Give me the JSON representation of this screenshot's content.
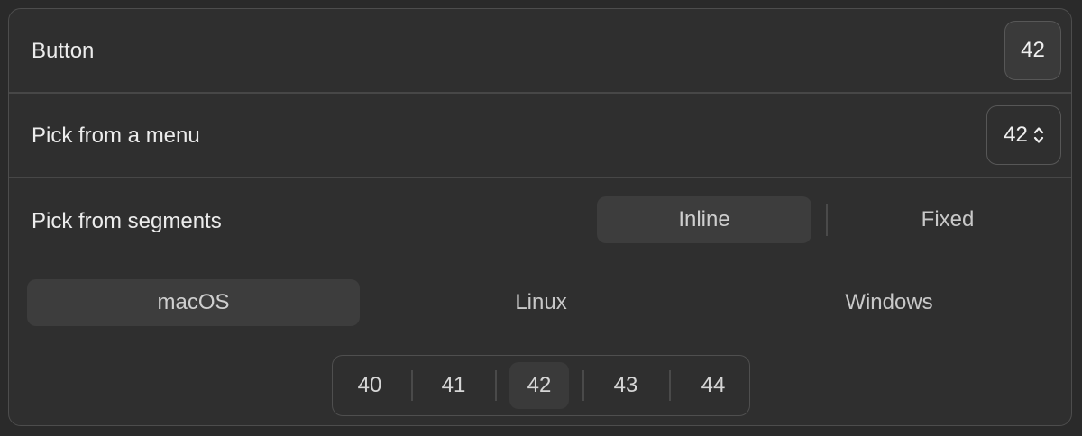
{
  "rows": {
    "button": {
      "label": "Button",
      "value": "42"
    },
    "menu": {
      "label": "Pick from a menu",
      "value": "42",
      "icon": "chevron-up-down-icon"
    },
    "segments": {
      "label": "Pick from segments",
      "style_options": [
        "Inline",
        "Fixed"
      ],
      "style_selected": "Inline",
      "os_options": [
        "macOS",
        "Linux",
        "Windows"
      ],
      "os_selected": "macOS",
      "number_options": [
        "40",
        "41",
        "42",
        "43",
        "44"
      ],
      "number_selected": "42"
    }
  },
  "colors": {
    "background": "#2a2a2a",
    "panel": "#2f2f2f",
    "selected_segment": "#3d3d3d",
    "border": "#4d4d4d",
    "text": "#ececec"
  }
}
